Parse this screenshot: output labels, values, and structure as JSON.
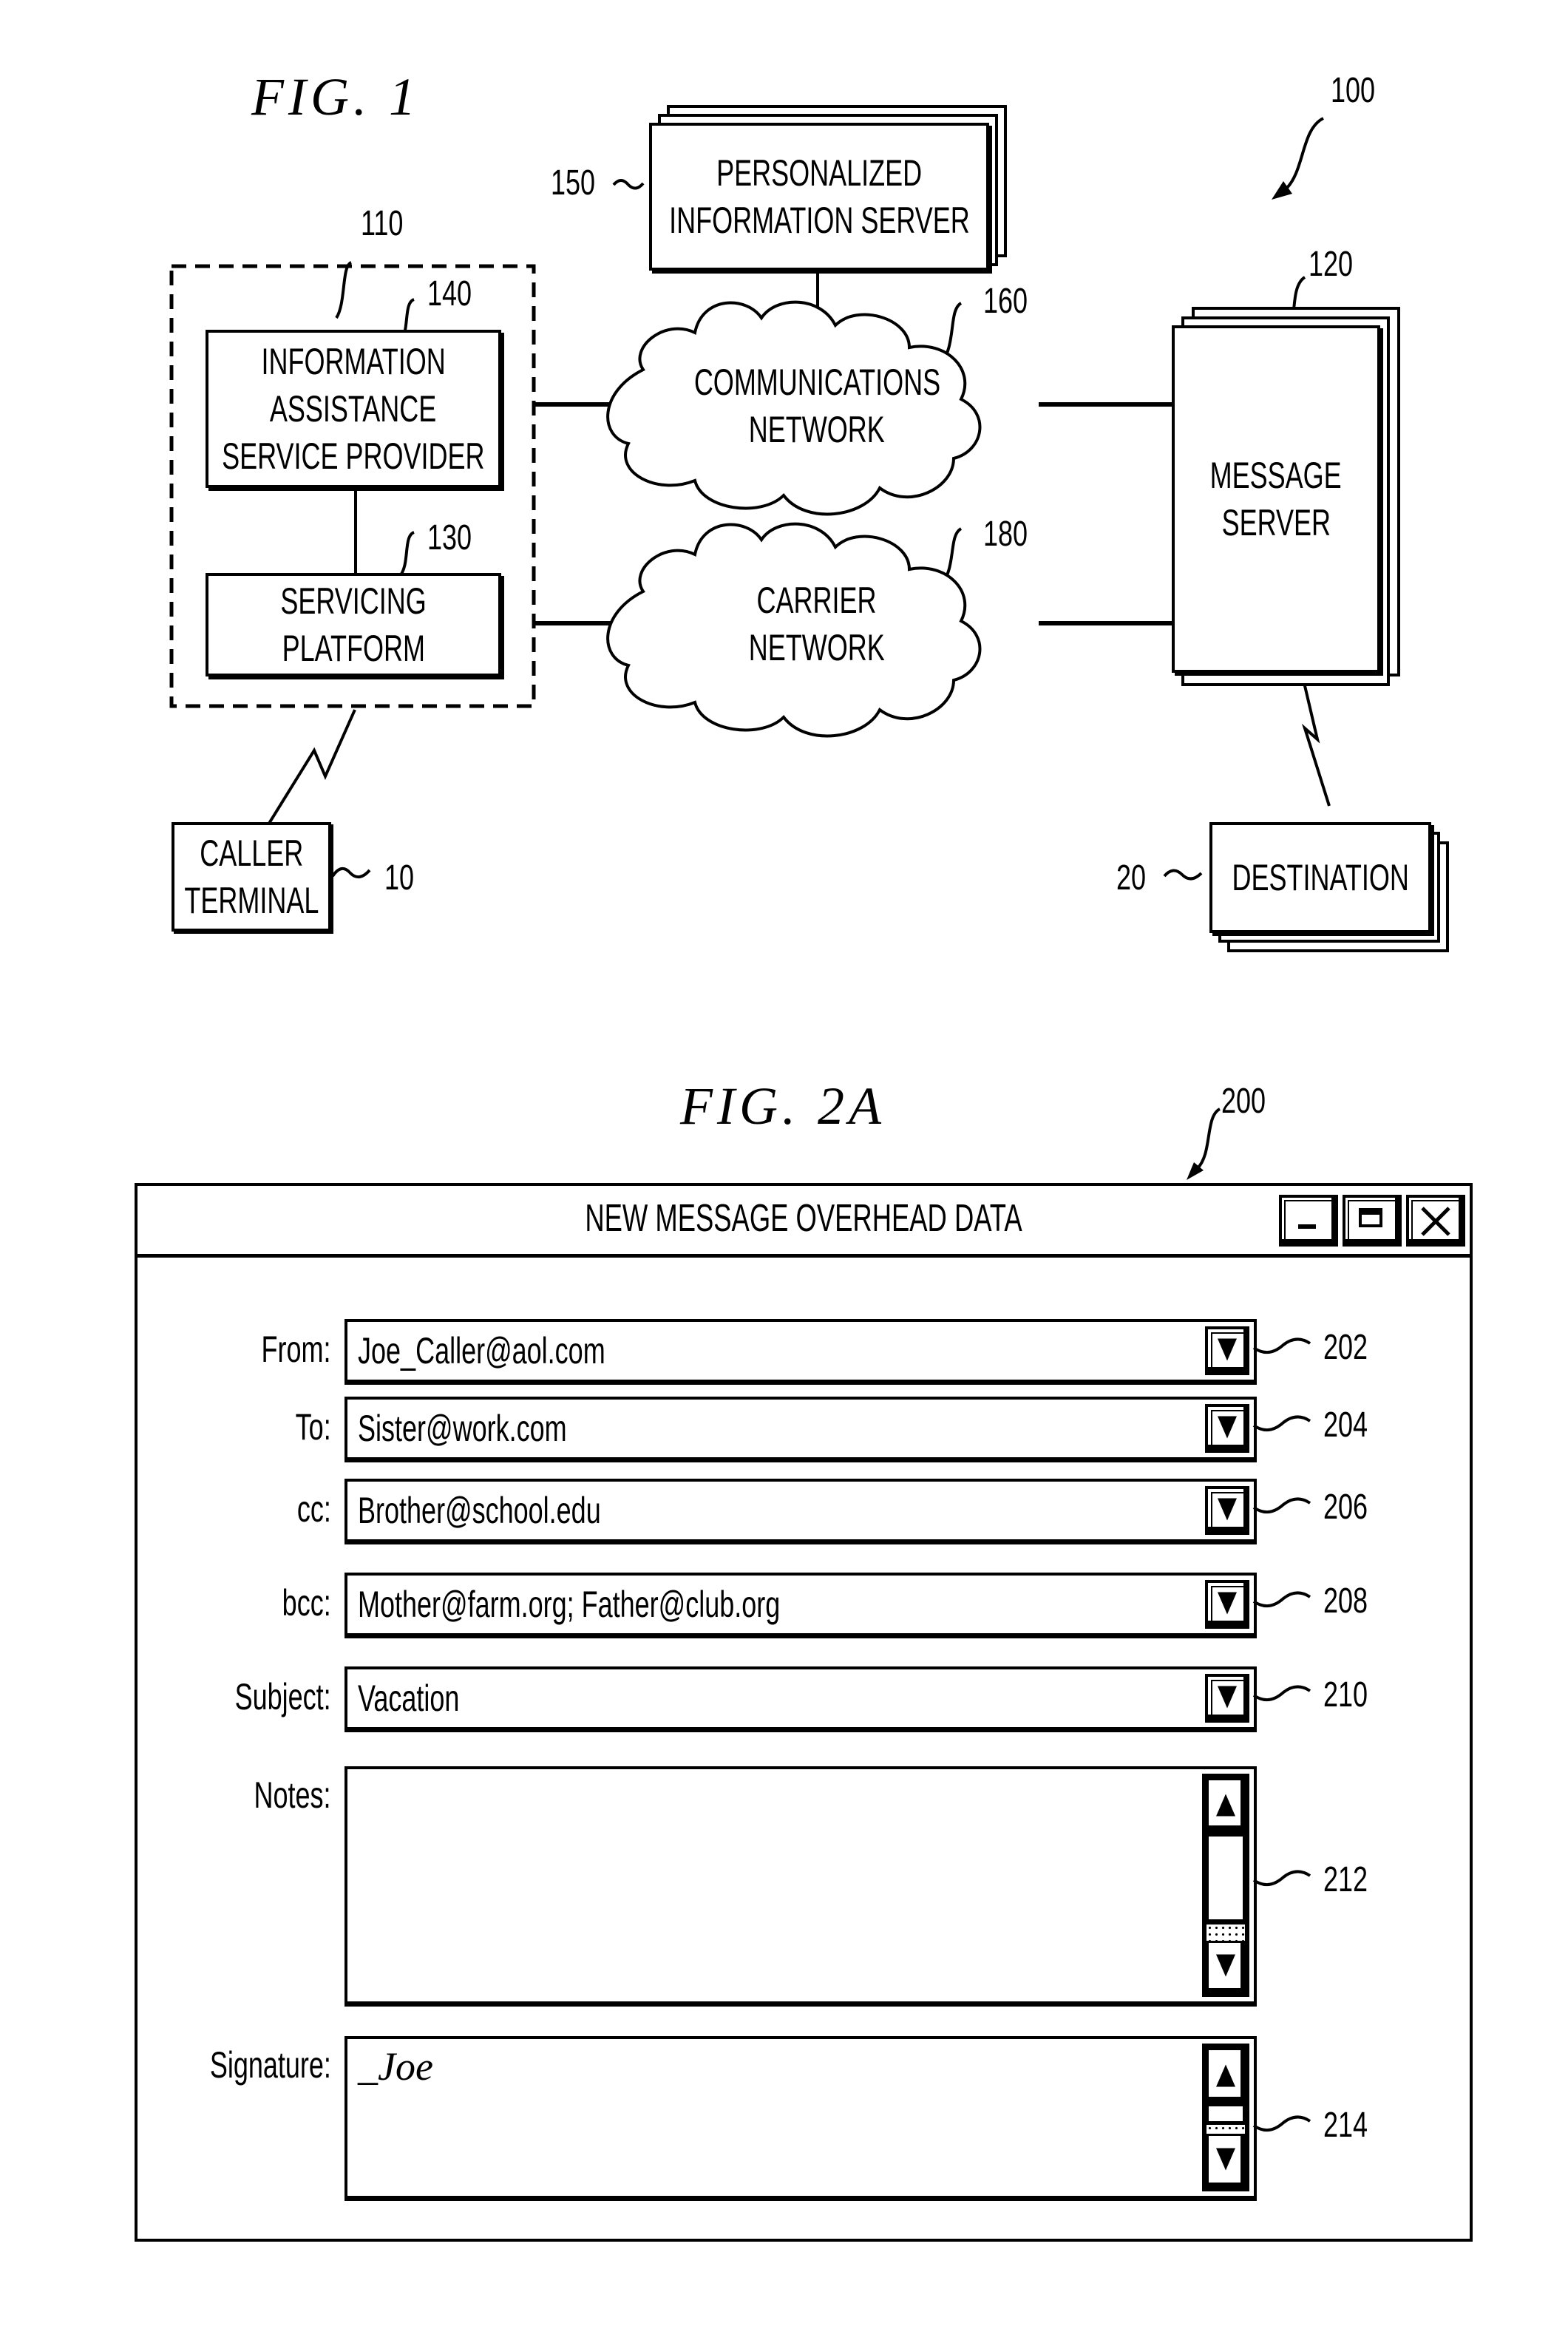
{
  "figure1": {
    "title": "FIG. 1",
    "system_ref": "100",
    "nodes": {
      "personalized_information_server": {
        "ref": "150",
        "lines": [
          "PERSONALIZED",
          "INFORMATION SERVER"
        ]
      },
      "group_110": {
        "ref": "110"
      },
      "information_assistance_service_provider": {
        "ref": "140",
        "lines": [
          "INFORMATION",
          "ASSISTANCE",
          "SERVICE PROVIDER"
        ]
      },
      "servicing_platform": {
        "ref": "130",
        "lines": [
          "SERVICING",
          "PLATFORM"
        ]
      },
      "communications_network": {
        "ref": "160",
        "lines": [
          "COMMUNICATIONS",
          "NETWORK"
        ]
      },
      "carrier_network": {
        "ref": "180",
        "lines": [
          "CARRIER",
          "NETWORK"
        ]
      },
      "message_server": {
        "ref": "120",
        "lines": [
          "MESSAGE",
          "SERVER"
        ]
      },
      "caller_terminal": {
        "ref": "10",
        "lines": [
          "CALLER",
          "TERMINAL"
        ]
      },
      "destination": {
        "ref": "20",
        "lines": [
          "DESTINATION"
        ]
      }
    }
  },
  "figure2a": {
    "title": "FIG. 2A",
    "window_ref": "200",
    "window": {
      "title": "NEW MESSAGE OVERHEAD DATA",
      "buttons": {
        "minimize": "minimize-icon",
        "maximize": "maximize-icon",
        "close": "close-icon"
      },
      "fields": [
        {
          "label": "From:",
          "value": "Joe_Caller@aol.com",
          "ref": "202",
          "type": "dropdown"
        },
        {
          "label": "To:",
          "value": "Sister@work.com",
          "ref": "204",
          "type": "dropdown"
        },
        {
          "label": "cc:",
          "value": "Brother@school.edu",
          "ref": "206",
          "type": "dropdown"
        },
        {
          "label": "bcc:",
          "value": "Mother@farm.org;  Father@club.org",
          "ref": "208",
          "type": "dropdown"
        },
        {
          "label": "Subject:",
          "value": "Vacation",
          "ref": "210",
          "type": "dropdown"
        },
        {
          "label": "Notes:",
          "value": "",
          "ref": "212",
          "type": "textarea"
        },
        {
          "label": "Signature:",
          "value": "_Joe",
          "ref": "214",
          "type": "textarea"
        }
      ]
    }
  }
}
